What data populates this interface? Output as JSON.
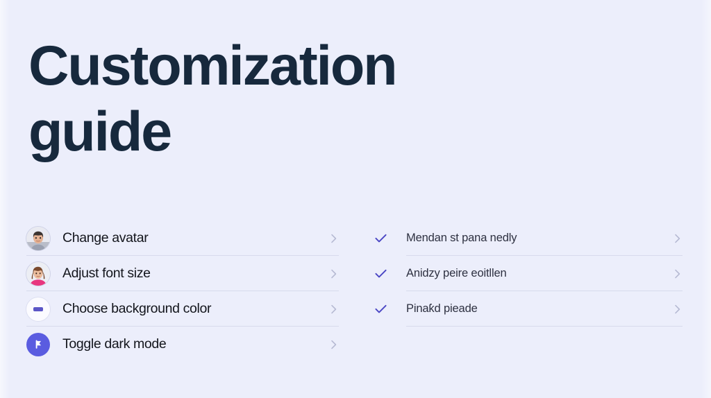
{
  "page": {
    "background_color": "#eceefb",
    "title": "Customization\nguide",
    "title_color": "#17293d"
  },
  "left_list": {
    "name": "settings-list",
    "accent_color": "#5a5ce0",
    "divider_color": "#d7daec",
    "items": [
      {
        "label": "Change avatar",
        "lead": "avatar-photo-male",
        "chevron": "chevron-right-icon"
      },
      {
        "label": "Adjust font size",
        "lead": "avatar-photo-female",
        "chevron": "chevron-right-icon"
      },
      {
        "label": "Choose background color",
        "lead": "color-swatch-icon",
        "chevron": "chevron-right-icon"
      },
      {
        "label": "Toggle dark mode",
        "lead": "flag-badge-icon",
        "chevron": "chevron-right-icon"
      }
    ]
  },
  "right_list": {
    "name": "checked-list",
    "check_color": "#4a46c4",
    "divider_color": "#d7daec",
    "items": [
      {
        "label": "Mendan st pana nedly",
        "lead": "check-icon",
        "chevron": "chevron-right-icon"
      },
      {
        "label": "Anidzy peire eoitllen",
        "lead": "check-icon",
        "chevron": "chevron-right-icon"
      },
      {
        "label": "Pinaƙd pieade",
        "lead": "check-icon",
        "chevron": "chevron-right-icon"
      }
    ]
  }
}
